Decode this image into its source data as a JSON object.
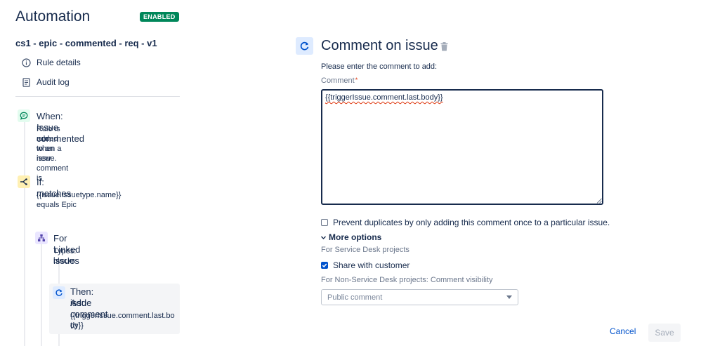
{
  "header": {
    "title": "Automation",
    "status_badge": "ENABLED",
    "badge_color": "#00875a"
  },
  "rule": {
    "name": "cs1 - epic - commented - req - v1"
  },
  "nav": {
    "items": [
      {
        "label": "Rule details",
        "icon": "info-icon"
      },
      {
        "label": "Audit log",
        "icon": "document-icon"
      }
    ]
  },
  "steps": {
    "trigger": {
      "title": "When: Issue commented",
      "desc_1": "Rule is run when a new comment is",
      "desc_2": "added to an issue.",
      "icon": "comment-icon",
      "color": "#e3fcef"
    },
    "condition": {
      "title": "If: matches",
      "desc": "{{issue.issuetype.name}} equals Epic",
      "icon": "branch-icon",
      "color": "#fff0b3"
    },
    "branch": {
      "title": "For Linked issues",
      "desc": "Types: blocks",
      "icon": "hierarchy-icon",
      "color": "#eae6ff"
    },
    "action": {
      "title_1": "Then: Add comment to",
      "title_2": "issue",
      "desc_1": "{{triggerIssue.comment.last.bo",
      "desc_2": "dy}}",
      "icon": "refresh-icon",
      "color": "#deebff"
    }
  },
  "panel": {
    "title": "Comment on issue",
    "prompt": "Please enter the comment to add:",
    "comment_label": "Comment",
    "required_marker": "*",
    "comment_value": "{{triggerIssue.comment.last.body}}",
    "prevent_duplicates_label": "Prevent duplicates by only adding this comment once to a particular issue.",
    "prevent_duplicates_checked": false,
    "more_options_label": "More options",
    "service_desk_label": "For Service Desk projects",
    "share_label": "Share with customer",
    "share_checked": true,
    "non_service_desk_label": "For Non-Service Desk projects: Comment visibility",
    "visibility_selected": "Public comment"
  },
  "footer": {
    "cancel_label": "Cancel",
    "save_label": "Save"
  },
  "colors": {
    "accent": "#0052cc",
    "text": "#172b4d",
    "muted": "#6b778c"
  }
}
